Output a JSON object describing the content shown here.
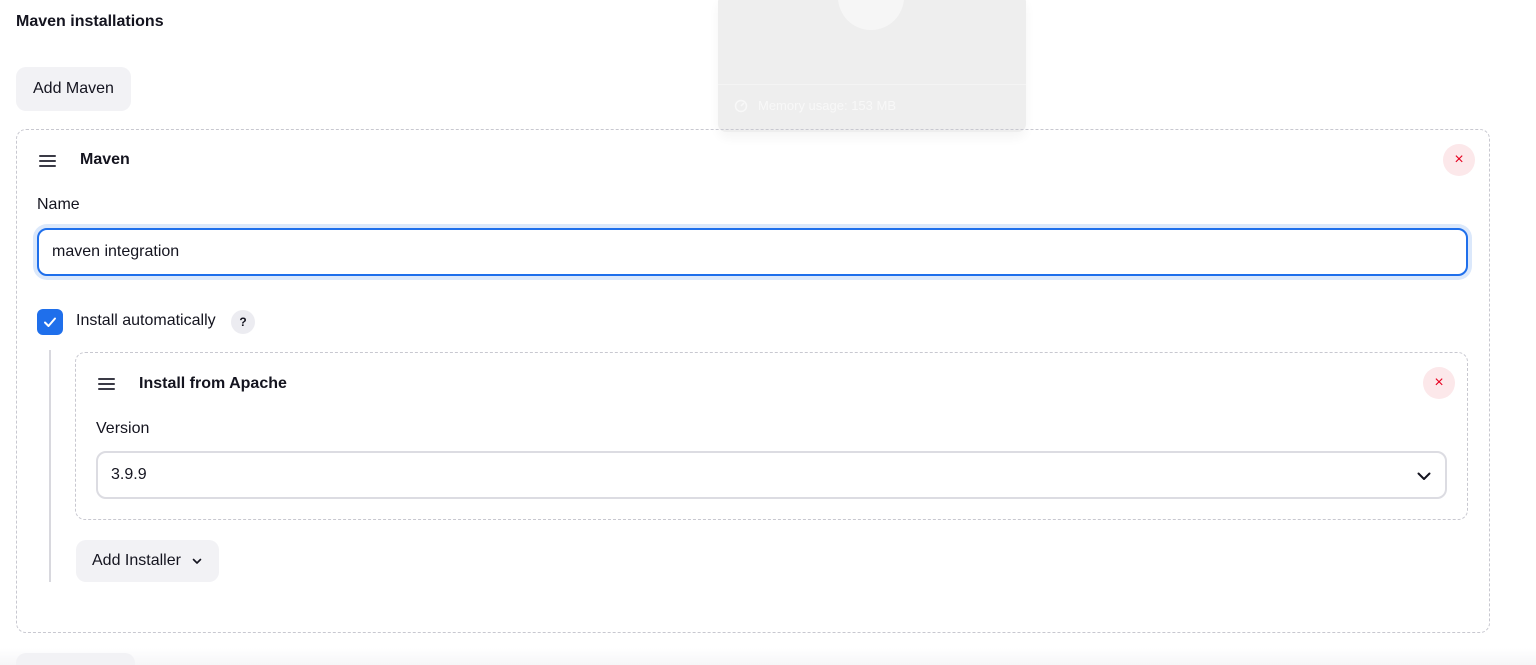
{
  "section": {
    "title": "Maven installations",
    "add_button": "Add Maven"
  },
  "maven_card": {
    "title": "Maven",
    "name_label": "Name",
    "name_value": "maven integration",
    "install_auto_label": "Install automatically",
    "install_auto_checked": true,
    "help_label": "?",
    "close_label": "×"
  },
  "installer_card": {
    "title": "Install from Apache",
    "version_label": "Version",
    "version_value": "3.9.9",
    "close_label": "×"
  },
  "add_installer_label": "Add Installer",
  "overlay": {
    "memory_text": "Memory usage: 153 MB"
  },
  "colors": {
    "accent": "#1f6feb",
    "danger": "#e6001f",
    "button_bg": "#f2f2f5"
  }
}
